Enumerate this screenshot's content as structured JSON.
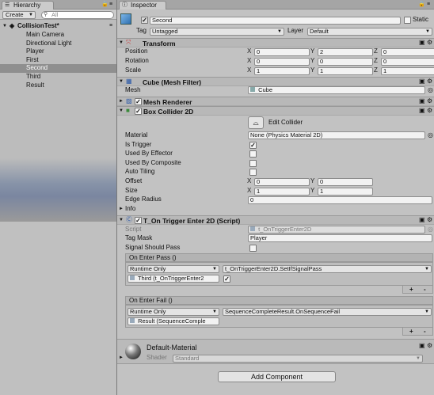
{
  "hierarchy": {
    "tab_label": "Hierarchy",
    "create_label": "Create",
    "search_placeholder": "All",
    "scene_name": "CollisionTest*",
    "items": [
      "Main Camera",
      "Directional Light",
      "Player",
      "First",
      "Second",
      "Third",
      "Result"
    ],
    "selected_index": 4
  },
  "inspector": {
    "tab_label": "Inspector",
    "object_name": "Second",
    "static_label": "Static",
    "tag_label": "Tag",
    "tag_value": "Untagged",
    "layer_label": "Layer",
    "layer_value": "Default",
    "transform": {
      "title": "Transform",
      "position_label": "Position",
      "rotation_label": "Rotation",
      "scale_label": "Scale",
      "axes": [
        "X",
        "Y",
        "Z"
      ],
      "position": [
        "0",
        "2",
        "0"
      ],
      "rotation": [
        "0",
        "0",
        "0"
      ],
      "scale": [
        "1",
        "1",
        "1"
      ]
    },
    "mesh_filter": {
      "title": "Cube (Mesh Filter)",
      "mesh_label": "Mesh",
      "mesh_value": "Cube"
    },
    "mesh_renderer": {
      "title": "Mesh Renderer"
    },
    "box_collider": {
      "title": "Box Collider 2D",
      "edit_collider": "Edit Collider",
      "material_label": "Material",
      "material_value": "None (Physics Material 2D)",
      "is_trigger_label": "Is Trigger",
      "is_trigger": true,
      "used_by_effector_label": "Used By Effector",
      "used_by_composite_label": "Used By Composite",
      "auto_tiling_label": "Auto Tiling",
      "offset_label": "Offset",
      "offset": [
        "0",
        "0"
      ],
      "size_label": "Size",
      "size": [
        "1",
        "1"
      ],
      "edge_radius_label": "Edge Radius",
      "edge_radius": "0",
      "axes": [
        "X",
        "Y"
      ],
      "info_label": "Info"
    },
    "script": {
      "title": "T_On Trigger Enter 2D (Script)",
      "script_label": "Script",
      "script_value": "t_OnTriggerEnter2D",
      "tag_mask_label": "Tag Mask",
      "tag_mask_value": "Player",
      "signal_label": "Signal Should Pass",
      "on_enter_pass": {
        "title": "On Enter Pass ()",
        "runtime": "Runtime Only",
        "function": "t_OnTriggerEnter2D.SetIfSignalPass",
        "object": "Third (t_OnTriggerEnter2",
        "checked": true
      },
      "on_enter_fail": {
        "title": "On Enter Fail ()",
        "runtime": "Runtime Only",
        "function": "SequenceCompleteResult.OnSequenceFail",
        "object": "Result (SequenceComple"
      },
      "plus": "+",
      "minus": "-"
    },
    "material": {
      "name": "Default-Material",
      "shader_label": "Shader",
      "shader_value": "Standard"
    },
    "add_component": "Add Component"
  }
}
